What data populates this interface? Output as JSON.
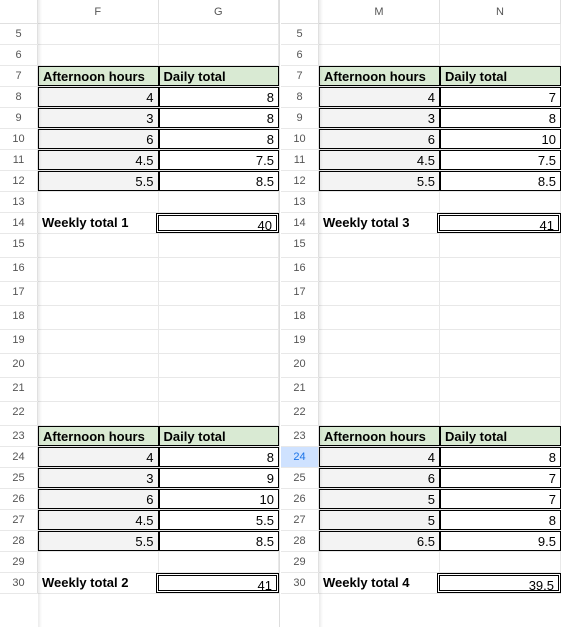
{
  "left": {
    "col_letters": [
      "F",
      "G"
    ],
    "row_numbers": [
      "5",
      "6",
      "7",
      "8",
      "9",
      "10",
      "11",
      "12",
      "13",
      "14",
      "15",
      "16",
      "17",
      "18",
      "19",
      "20",
      "21",
      "22",
      "23",
      "24",
      "25",
      "26",
      "27",
      "28",
      "29",
      "30"
    ],
    "block1": {
      "headers": [
        "Afternoon hours",
        "Daily total"
      ],
      "rows": [
        [
          "4",
          "8"
        ],
        [
          "3",
          "8"
        ],
        [
          "6",
          "8"
        ],
        [
          "4.5",
          "7.5"
        ],
        [
          "5.5",
          "8.5"
        ]
      ],
      "total_label": "Weekly total 1",
      "total_value": "40"
    },
    "block2": {
      "headers": [
        "Afternoon hours",
        "Daily total"
      ],
      "rows": [
        [
          "4",
          "8"
        ],
        [
          "3",
          "9"
        ],
        [
          "6",
          "10"
        ],
        [
          "4.5",
          "5.5"
        ],
        [
          "5.5",
          "8.5"
        ]
      ],
      "total_label": "Weekly total 2",
      "total_value": "41"
    }
  },
  "right": {
    "col_letters": [
      "M",
      "N"
    ],
    "row_numbers": [
      "5",
      "6",
      "7",
      "8",
      "9",
      "10",
      "11",
      "12",
      "13",
      "14",
      "15",
      "16",
      "17",
      "18",
      "19",
      "20",
      "21",
      "22",
      "23",
      "24",
      "25",
      "26",
      "27",
      "28",
      "29",
      "30"
    ],
    "block1": {
      "headers": [
        "Afternoon hours",
        "Daily total"
      ],
      "rows": [
        [
          "4",
          "7"
        ],
        [
          "3",
          "8"
        ],
        [
          "6",
          "10"
        ],
        [
          "4.5",
          "7.5"
        ],
        [
          "5.5",
          "8.5"
        ]
      ],
      "total_label": "Weekly total 3",
      "total_value": "41"
    },
    "block2": {
      "headers": [
        "Afternoon hours",
        "Daily total"
      ],
      "rows": [
        [
          "4",
          "8"
        ],
        [
          "6",
          "7"
        ],
        [
          "5",
          "7"
        ],
        [
          "5",
          "8"
        ],
        [
          "6.5",
          "9.5"
        ]
      ],
      "total_label": "Weekly total 4",
      "total_value": "39.5"
    },
    "selected_row_index": 19
  },
  "chart_data": [
    {
      "type": "table",
      "title": "Weekly total 1",
      "columns": [
        "Afternoon hours",
        "Daily total"
      ],
      "rows": [
        [
          4,
          8
        ],
        [
          3,
          8
        ],
        [
          6,
          8
        ],
        [
          4.5,
          7.5
        ],
        [
          5.5,
          8.5
        ]
      ],
      "total": 40
    },
    {
      "type": "table",
      "title": "Weekly total 2",
      "columns": [
        "Afternoon hours",
        "Daily total"
      ],
      "rows": [
        [
          4,
          8
        ],
        [
          3,
          9
        ],
        [
          6,
          10
        ],
        [
          4.5,
          5.5
        ],
        [
          5.5,
          8.5
        ]
      ],
      "total": 41
    },
    {
      "type": "table",
      "title": "Weekly total 3",
      "columns": [
        "Afternoon hours",
        "Daily total"
      ],
      "rows": [
        [
          4,
          7
        ],
        [
          3,
          8
        ],
        [
          6,
          10
        ],
        [
          4.5,
          7.5
        ],
        [
          5.5,
          8.5
        ]
      ],
      "total": 41
    },
    {
      "type": "table",
      "title": "Weekly total 4",
      "columns": [
        "Afternoon hours",
        "Daily total"
      ],
      "rows": [
        [
          4,
          8
        ],
        [
          6,
          7
        ],
        [
          5,
          7
        ],
        [
          5,
          8
        ],
        [
          6.5,
          9.5
        ]
      ],
      "total": 39.5
    }
  ]
}
